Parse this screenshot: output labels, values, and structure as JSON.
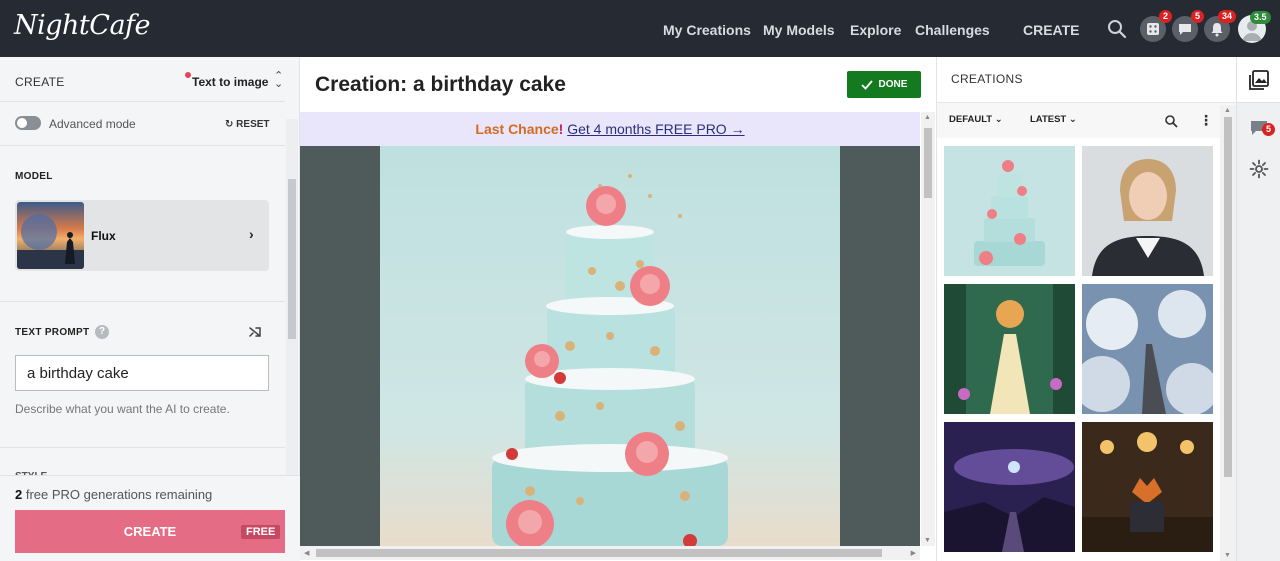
{
  "header": {
    "logo": "NightCafe",
    "nav": [
      "My Creations",
      "My Models",
      "Explore",
      "Challenges"
    ],
    "create_label": "CREATE",
    "badges": {
      "dice": "2",
      "chat": "5",
      "bell": "34",
      "level": "3.5"
    }
  },
  "left": {
    "title": "CREATE",
    "mode": "Text to image",
    "advanced_label": "Advanced mode",
    "reset_label": "RESET",
    "model_label": "MODEL",
    "model_name": "Flux",
    "prompt_label": "TEXT PROMPT",
    "prompt_value": "a birthday cake",
    "prompt_help": "Describe what you want the AI to create.",
    "style_label": "STYLE",
    "remaining_count": "2",
    "remaining_text": " free PRO generations remaining",
    "create_button": "CREATE",
    "free_tag": "FREE"
  },
  "center": {
    "title": "Creation: a birthday cake",
    "done_label": "DONE",
    "promo_part1": "Last Chance",
    "promo_part2": "!",
    "promo_offer": "Get 4 months FREE PRO →"
  },
  "right": {
    "title": "CREATIONS",
    "filter_sort": "DEFAULT",
    "filter_time": "LATEST",
    "rail_badge": "5",
    "thumbnails": [
      "birthday-cake",
      "woman-portrait",
      "forest-woman",
      "stairway-clouds",
      "galaxy-stairs",
      "fox-banquet"
    ]
  },
  "colors": {
    "header_bg": "#252a33",
    "create_button": "#e56c85",
    "done_button": "#137a1f",
    "promo_bg": "#e9e6fb",
    "badge_red": "#d92323"
  }
}
